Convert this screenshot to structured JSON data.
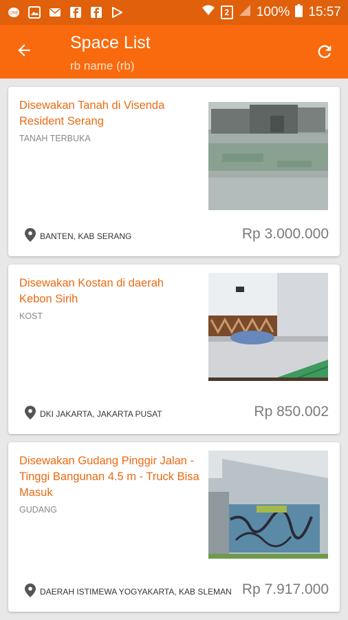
{
  "status_bar": {
    "battery": "100%",
    "time": "15:57",
    "sim": "2",
    "icons": [
      "line-icon",
      "image-icon",
      "sms-icon",
      "facebook-icon",
      "facebook-icon",
      "play-store-icon",
      "wifi-icon",
      "signal-icon",
      "battery-icon"
    ]
  },
  "app_bar": {
    "title": "Space List",
    "subtitle": "rb name (rb)",
    "back_icon": "arrow-left-icon",
    "refresh_icon": "refresh-icon"
  },
  "listings": [
    {
      "title": "Disewakan Tanah di Visenda Resident Serang",
      "type": "TANAH TERBUKA",
      "location": "BANTEN, KAB SERANG",
      "price": "Rp 3.000.000",
      "image": "land-photo"
    },
    {
      "title": "Disewakan Kostan di daerah Kebon Sirih",
      "type": "KOST",
      "location": "DKI JAKARTA, JAKARTA PUSAT",
      "price": "Rp 850.002",
      "image": "bedroom-photo"
    },
    {
      "title": "Disewakan Gudang Pinggir Jalan - Tinggi Bangunan 4.5 m - Truck Bisa Masuk",
      "type": "GUDANG",
      "location": "DAERAH ISTIMEWA YOGYAKARTA, KAB SLEMAN",
      "price": "Rp 7.917.000",
      "image": "warehouse-photo"
    }
  ],
  "colors": {
    "status_bar": "#e0600c",
    "app_bar": "#f86a0d",
    "title_text": "#ea6a12"
  }
}
